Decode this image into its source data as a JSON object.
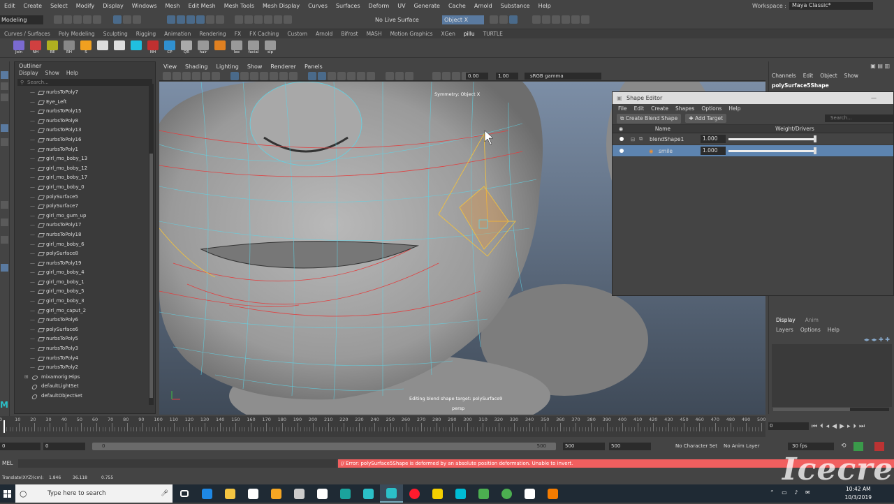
{
  "menubar": [
    "Edit",
    "Create",
    "Select",
    "Modify",
    "Display",
    "Windows",
    "Mesh",
    "Edit Mesh",
    "Mesh Tools",
    "Mesh Display",
    "Curves",
    "Surfaces",
    "Deform",
    "UV",
    "Generate",
    "Cache",
    "Arnold",
    "Substance",
    "Help"
  ],
  "workspace": {
    "label": "Workspace :",
    "value": "Maya Classic*"
  },
  "status": {
    "mode": "Modeling",
    "live_surface": "No Live Surface",
    "object": "Object X"
  },
  "shelf_tabs": [
    "Curves / Surfaces",
    "Poly Modeling",
    "Sculpting",
    "Rigging",
    "Animation",
    "Rendering",
    "FX",
    "FX Caching",
    "Custom",
    "Arnold",
    "Bifrost",
    "MASH",
    "Motion Graphics",
    "XGen",
    "pillu",
    "TURTLE"
  ],
  "shelf_active": "pillu",
  "shelf_icons": [
    {
      "label": "Join",
      "color": "#7a6ad0"
    },
    {
      "label": "NH",
      "color": "#d04040"
    },
    {
      "label": "RE",
      "color": "#b0b020"
    },
    {
      "label": "RH",
      "color": "#888888"
    },
    {
      "label": "S",
      "color": "#f0a020"
    },
    {
      "label": "",
      "color": "#dddddd"
    },
    {
      "label": "",
      "color": "#dddddd"
    },
    {
      "label": "",
      "color": "#20c0e0"
    },
    {
      "label": "NH",
      "color": "#c03030"
    },
    {
      "label": "CP",
      "color": "#3090d0"
    },
    {
      "label": "QR",
      "color": "#aaaaaa"
    },
    {
      "label": "hair",
      "color": "#999999"
    },
    {
      "label": "",
      "color": "#e08020"
    },
    {
      "label": "lee",
      "color": "#999999"
    },
    {
      "label": "facial",
      "color": "#999999"
    },
    {
      "label": "sip",
      "color": "#999999"
    }
  ],
  "outliner": {
    "title": "Outliner",
    "menu": [
      "Display",
      "Show",
      "Help"
    ],
    "search_placeholder": "Search...",
    "items": [
      {
        "name": "nurbsToPoly7",
        "type": "mesh"
      },
      {
        "name": "Eye_Left",
        "type": "mesh"
      },
      {
        "name": "nurbsToPoly15",
        "type": "mesh"
      },
      {
        "name": "nurbsToPoly8",
        "type": "mesh"
      },
      {
        "name": "nurbsToPoly13",
        "type": "mesh"
      },
      {
        "name": "nurbsToPoly16",
        "type": "mesh"
      },
      {
        "name": "nurbsToPoly1",
        "type": "mesh"
      },
      {
        "name": "girl_mo_boby_13",
        "type": "mesh"
      },
      {
        "name": "girl_mo_boby_12",
        "type": "mesh"
      },
      {
        "name": "girl_mo_boby_17",
        "type": "mesh"
      },
      {
        "name": "girl_mo_boby_0",
        "type": "mesh"
      },
      {
        "name": "polySurface5",
        "type": "mesh"
      },
      {
        "name": "polySurface7",
        "type": "mesh"
      },
      {
        "name": "girl_mo_gum_up",
        "type": "mesh"
      },
      {
        "name": "nurbsToPoly17",
        "type": "mesh"
      },
      {
        "name": "nurbsToPoly18",
        "type": "mesh"
      },
      {
        "name": "girl_mo_boby_6",
        "type": "mesh"
      },
      {
        "name": "polySurface8",
        "type": "mesh"
      },
      {
        "name": "nurbsToPoly19",
        "type": "mesh"
      },
      {
        "name": "girl_mo_boby_4",
        "type": "mesh"
      },
      {
        "name": "girl_mo_boby_1",
        "type": "mesh"
      },
      {
        "name": "girl_mo_boby_5",
        "type": "mesh"
      },
      {
        "name": "girl_mo_boby_3",
        "type": "mesh"
      },
      {
        "name": "girl_mo_caput_2",
        "type": "mesh"
      },
      {
        "name": "nurbsToPoly6",
        "type": "mesh"
      },
      {
        "name": "polySurface6",
        "type": "mesh"
      },
      {
        "name": "nurbsToPoly5",
        "type": "mesh"
      },
      {
        "name": "nurbsToPoly3",
        "type": "mesh"
      },
      {
        "name": "nurbsToPoly4",
        "type": "mesh"
      },
      {
        "name": "nurbsToPoly2",
        "type": "mesh"
      },
      {
        "name": "mixamorig:Hips",
        "type": "joint"
      },
      {
        "name": "defaultLightSet",
        "type": "set"
      },
      {
        "name": "defaultObjectSet",
        "type": "set"
      }
    ]
  },
  "viewport": {
    "menu": [
      "View",
      "Shading",
      "Lighting",
      "Show",
      "Renderer",
      "Panels"
    ],
    "field1": "0.00",
    "field2": "1.00",
    "color_space": "sRGB gamma",
    "symmetry": "Symmetry: Object X",
    "editing": "Editing blend shape target: polySurface9",
    "camera": "persp"
  },
  "shape_editor": {
    "title": "Shape Editor",
    "menu": [
      "File",
      "Edit",
      "Create",
      "Shapes",
      "Options",
      "Help"
    ],
    "create_btn": "Create Blend Shape",
    "add_btn": "Add Target",
    "search_placeholder": "Search...",
    "col_name": "Name",
    "col_weight": "Weight/Drivers",
    "rows": [
      {
        "name": "blendShape1",
        "weight": "1.000",
        "level": 1.0,
        "selected": false
      },
      {
        "name": "smile",
        "weight": "1.000",
        "level": 1.0,
        "selected": true
      }
    ]
  },
  "channel_box": {
    "menu": [
      "Channels",
      "Edit",
      "Object",
      "Show"
    ],
    "object": "polySurface5Shape",
    "layer_tabs": [
      "Display",
      "Anim"
    ],
    "layer_menu": [
      "Layers",
      "Options",
      "Help"
    ]
  },
  "timeline": {
    "ticks": [
      "0",
      "10",
      "20",
      "30",
      "40",
      "50",
      "60",
      "70",
      "80",
      "90",
      "100",
      "110",
      "120",
      "130",
      "140",
      "150",
      "160",
      "170",
      "180",
      "190",
      "200",
      "210",
      "220",
      "230",
      "240",
      "250",
      "260",
      "270",
      "280",
      "290",
      "300",
      "310",
      "320",
      "330",
      "340",
      "350",
      "360",
      "370",
      "380",
      "390",
      "400",
      "410",
      "420",
      "430",
      "450",
      "460",
      "470",
      "480",
      "490",
      "500"
    ],
    "current_frame": "0"
  },
  "range": {
    "start": "0",
    "start2": "0",
    "slider_start": "0",
    "slider_end": "500",
    "end": "500",
    "end2": "500",
    "character": "No Character Set",
    "anim_layer": "No Anim Layer",
    "fps": "30 fps"
  },
  "mel": {
    "label": "MEL",
    "error": "// Error: polySurface5Shape is deformed by an absolute position deformation.  Unable to invert."
  },
  "helpline": {
    "label": "Translate(XYZ)(cm):",
    "x": "1.846",
    "y": "36.118",
    "z": "0.755"
  },
  "taskbar": {
    "search": "Type here to search",
    "time": "10:42 AM",
    "date": "10/3/2019",
    "apps": [
      {
        "name": "task-view",
        "color": "#ffffff"
      },
      {
        "name": "edge",
        "color": "#1e88e5"
      },
      {
        "name": "explorer",
        "color": "#f4c542"
      },
      {
        "name": "store",
        "color": "#ffffff"
      },
      {
        "name": "app-tool",
        "color": "#f5a623"
      },
      {
        "name": "app-bird",
        "color": "#cccccc"
      },
      {
        "name": "mail",
        "color": "#ffffff"
      },
      {
        "name": "app-teal",
        "color": "#1ba39c"
      },
      {
        "name": "maya-1",
        "color": "#2bc0c8"
      },
      {
        "name": "maya-2",
        "color": "#2bc0c8"
      },
      {
        "name": "opera",
        "color": "#ff1b2d"
      },
      {
        "name": "app-yellow",
        "color": "#f5d000"
      },
      {
        "name": "app-cyan",
        "color": "#00bcd4"
      },
      {
        "name": "app-green",
        "color": "#4caf50"
      },
      {
        "name": "chrome",
        "color": "#4caf50"
      },
      {
        "name": "photos",
        "color": "#ffffff"
      },
      {
        "name": "app-orange",
        "color": "#f57c00"
      }
    ]
  },
  "watermark": "Icecream"
}
